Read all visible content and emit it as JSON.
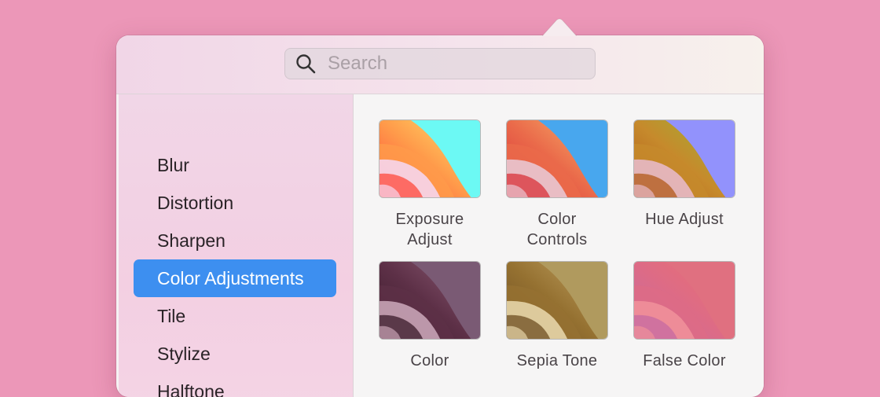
{
  "search": {
    "placeholder": "Search",
    "value": ""
  },
  "sidebar": {
    "items": [
      {
        "label": "Blur",
        "selected": false
      },
      {
        "label": "Distortion",
        "selected": false
      },
      {
        "label": "Sharpen",
        "selected": false
      },
      {
        "label": "Color Adjustments",
        "selected": true
      },
      {
        "label": "Tile",
        "selected": false
      },
      {
        "label": "Stylize",
        "selected": false
      },
      {
        "label": "Halftone",
        "selected": false
      }
    ]
  },
  "filters": [
    {
      "line1": "Exposure",
      "line2": "Adjust",
      "palette": [
        "#ff4a3c",
        "#ff9a4a",
        "#ffe36a",
        "#f6d5ec",
        "#6cf9f4"
      ]
    },
    {
      "line1": "Color",
      "line2": "Controls",
      "palette": [
        "#d8333a",
        "#ea6a4a",
        "#f7b26a",
        "#e9c6d2",
        "#48a7ee"
      ]
    },
    {
      "line1": "Hue Adjust",
      "line2": "",
      "palette": [
        "#b15a18",
        "#c68a2c",
        "#9eb334",
        "#e7b9c6",
        "#9292fc"
      ]
    },
    {
      "line1": "Color",
      "line2": "",
      "palette": [
        "#3a1a2a",
        "#5d3047",
        "#8b5a73",
        "#c7a3b5",
        "#7a5a74"
      ]
    },
    {
      "line1": "Sepia Tone",
      "line2": "",
      "palette": [
        "#6e4e22",
        "#957131",
        "#bfa060",
        "#e6d4a8",
        "#b09a5e"
      ]
    },
    {
      "line1": "False Color",
      "line2": "",
      "palette": [
        "#c56aa2",
        "#dd6b86",
        "#ea7072",
        "#f0909a",
        "#e07080"
      ]
    }
  ],
  "colors": {
    "background": "#ec97b8",
    "selection": "#3d8ff0",
    "sidebar": "#f1d6e7",
    "content": "#f6f5f5"
  }
}
